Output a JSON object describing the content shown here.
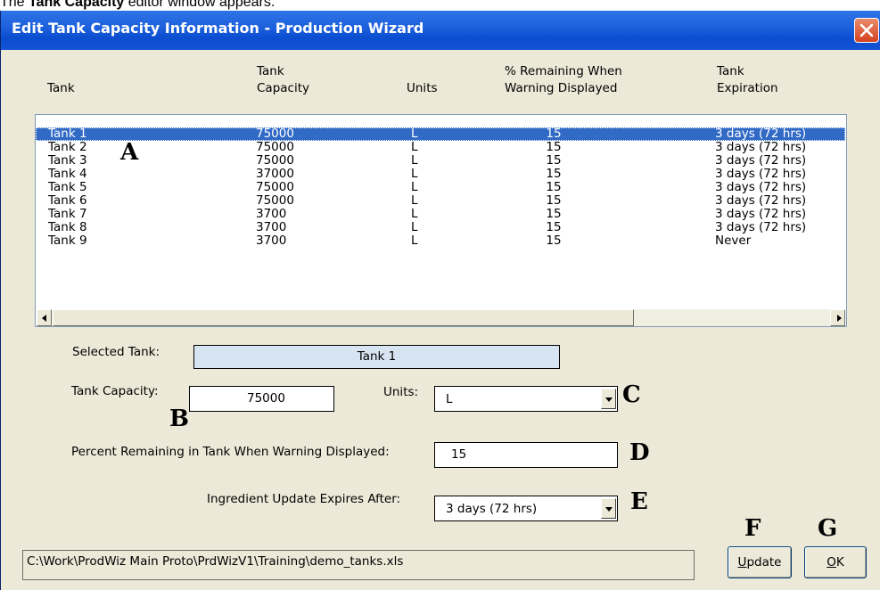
{
  "caption": {
    "prefix": "The ",
    "bold": "Tank Capacity",
    "suffix": " editor window appears."
  },
  "window": {
    "title": "Edit Tank Capacity Information - Production Wizard"
  },
  "columns": {
    "tank": [
      "Tank"
    ],
    "capacity": [
      "Tank",
      "Capacity"
    ],
    "units": [
      "Units"
    ],
    "warning": [
      "% Remaining When",
      "Warning Displayed"
    ],
    "expiration": [
      "Tank",
      "Expiration"
    ]
  },
  "rows": [
    {
      "tank": "Tank 1",
      "capacity": "75000",
      "units": "L",
      "warning": "15",
      "expiration": "3 days (72 hrs)",
      "selected": true
    },
    {
      "tank": "Tank 2",
      "capacity": "75000",
      "units": "L",
      "warning": "15",
      "expiration": "3 days (72 hrs)"
    },
    {
      "tank": "Tank 3",
      "capacity": "75000",
      "units": "L",
      "warning": "15",
      "expiration": "3 days (72 hrs)"
    },
    {
      "tank": "Tank 4",
      "capacity": "37000",
      "units": "L",
      "warning": "15",
      "expiration": "3 days (72 hrs)"
    },
    {
      "tank": "Tank 5",
      "capacity": "75000",
      "units": "L",
      "warning": "15",
      "expiration": "3 days (72 hrs)"
    },
    {
      "tank": "Tank 6",
      "capacity": "75000",
      "units": "L",
      "warning": "15",
      "expiration": "3 days (72 hrs)"
    },
    {
      "tank": "Tank 7",
      "capacity": "3700",
      "units": "L",
      "warning": "15",
      "expiration": "3 days (72 hrs)"
    },
    {
      "tank": "Tank 8",
      "capacity": "3700",
      "units": "L",
      "warning": "15",
      "expiration": "3 days (72 hrs)"
    },
    {
      "tank": "Tank 9",
      "capacity": "3700",
      "units": "L",
      "warning": "15",
      "expiration": "Never"
    }
  ],
  "form": {
    "selected_tank_label": "Selected Tank:",
    "selected_tank_value": "Tank 1",
    "capacity_label": "Tank Capacity:",
    "capacity_value": "75000",
    "units_label": "Units:",
    "units_value": "L",
    "warning_label": "Percent Remaining in Tank When Warning  Displayed:",
    "warning_value": "15",
    "expires_label": "Ingredient Update Expires After:",
    "expires_value": "3 days (72 hrs)"
  },
  "callouts": {
    "a": "A",
    "b": "B",
    "c": "C",
    "d": "D",
    "e": "E",
    "f": "F",
    "g": "G"
  },
  "file_path": "C:\\Work\\ProdWiz Main Proto\\PrdWizV1\\Training\\demo_tanks.xls",
  "buttons": {
    "update": {
      "accel": "U",
      "rest": "pdate"
    },
    "ok": {
      "accel": "O",
      "rest": "K"
    }
  },
  "colors": {
    "titlebar": "#0a4dd0",
    "selection": "#316ac5",
    "dialog_bg": "#ece9d8",
    "selected_field": "#d7e4f2",
    "close": "#d4421f"
  }
}
